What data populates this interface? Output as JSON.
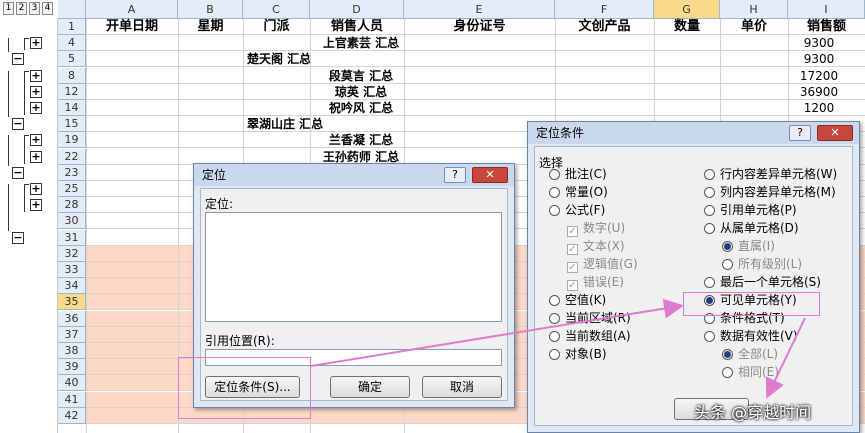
{
  "outline_levels": [
    "1",
    "2",
    "3",
    "4"
  ],
  "columns": [
    {
      "letter": "A",
      "header": "开单日期"
    },
    {
      "letter": "B",
      "header": "星期"
    },
    {
      "letter": "C",
      "header": "门派"
    },
    {
      "letter": "D",
      "header": "销售人员"
    },
    {
      "letter": "E",
      "header": "身份证号"
    },
    {
      "letter": "F",
      "header": "文创产品"
    },
    {
      "letter": "G",
      "header": "数量"
    },
    {
      "letter": "H",
      "header": "单价"
    },
    {
      "letter": "I",
      "header": "销售额"
    }
  ],
  "rows": [
    {
      "num": "1",
      "c": "",
      "d": "",
      "i": ""
    },
    {
      "num": "4",
      "c": "",
      "d": "上官素芸 汇总",
      "i": "9300"
    },
    {
      "num": "5",
      "c": "楚天阁 汇总",
      "d": "",
      "i": "9300"
    },
    {
      "num": "8",
      "c": "",
      "d": "段莫言 汇总",
      "i": "17200"
    },
    {
      "num": "12",
      "c": "",
      "d": "琼英 汇总",
      "i": "36900"
    },
    {
      "num": "14",
      "c": "",
      "d": "祝吟风 汇总",
      "i": "1200"
    },
    {
      "num": "15",
      "c": "翠湖山庄 汇总",
      "d": "",
      "i": ""
    },
    {
      "num": "19",
      "c": "",
      "d": "兰香凝 汇总",
      "i": ""
    },
    {
      "num": "22",
      "c": "",
      "d": "王孙药师 汇总",
      "i": ""
    },
    {
      "num": "23",
      "c": "",
      "d": "",
      "i": ""
    },
    {
      "num": "25",
      "c": "",
      "d": "",
      "i": ""
    },
    {
      "num": "28",
      "c": "",
      "d": "",
      "i": ""
    },
    {
      "num": "30",
      "c": "",
      "d": "",
      "i": ""
    },
    {
      "num": "31",
      "c": "",
      "d": "",
      "i": ""
    },
    {
      "num": "32",
      "c": "",
      "d": "",
      "i": ""
    },
    {
      "num": "33",
      "c": "",
      "d": "",
      "i": ""
    },
    {
      "num": "34",
      "c": "",
      "d": "",
      "i": ""
    },
    {
      "num": "35",
      "c": "",
      "d": "",
      "i": ""
    },
    {
      "num": "36",
      "c": "",
      "d": "",
      "i": ""
    },
    {
      "num": "37",
      "c": "",
      "d": "",
      "i": ""
    },
    {
      "num": "38",
      "c": "",
      "d": "",
      "i": ""
    },
    {
      "num": "39",
      "c": "",
      "d": "",
      "i": ""
    },
    {
      "num": "40",
      "c": "",
      "d": "",
      "i": ""
    },
    {
      "num": "41",
      "c": "",
      "d": "",
      "i": ""
    },
    {
      "num": "42",
      "c": "",
      "d": "",
      "i": ""
    }
  ],
  "goto_dialog": {
    "title": "定位",
    "help": "?",
    "close": "✕",
    "goto_label": "定位:",
    "reference_label": "引用位置(R):",
    "special_button": "定位条件(S)...",
    "ok_button": "确定",
    "cancel_button": "取消"
  },
  "special_dialog": {
    "title": "定位条件",
    "help": "?",
    "close": "✕",
    "section_label": "选择",
    "left_options": [
      {
        "label": "批注(C)",
        "type": "radio",
        "checked": false,
        "disabled": false
      },
      {
        "label": "常量(O)",
        "type": "radio",
        "checked": false,
        "disabled": false
      },
      {
        "label": "公式(F)",
        "type": "radio",
        "checked": false,
        "disabled": false
      },
      {
        "label": "数字(U)",
        "type": "check",
        "checked": true,
        "disabled": true
      },
      {
        "label": "文本(X)",
        "type": "check",
        "checked": true,
        "disabled": true
      },
      {
        "label": "逻辑值(G)",
        "type": "check",
        "checked": true,
        "disabled": true
      },
      {
        "label": "错误(E)",
        "type": "check",
        "checked": true,
        "disabled": true
      },
      {
        "label": "空值(K)",
        "type": "radio",
        "checked": false,
        "disabled": false
      },
      {
        "label": "当前区域(R)",
        "type": "radio",
        "checked": false,
        "disabled": false
      },
      {
        "label": "当前数组(A)",
        "type": "radio",
        "checked": false,
        "disabled": false
      },
      {
        "label": "对象(B)",
        "type": "radio",
        "checked": false,
        "disabled": false
      }
    ],
    "right_options": [
      {
        "label": "行内容差异单元格(W)",
        "type": "radio",
        "checked": false,
        "disabled": false
      },
      {
        "label": "列内容差异单元格(M)",
        "type": "radio",
        "checked": false,
        "disabled": false
      },
      {
        "label": "引用单元格(P)",
        "type": "radio",
        "checked": false,
        "disabled": false
      },
      {
        "label": "从属单元格(D)",
        "type": "radio",
        "checked": false,
        "disabled": false
      },
      {
        "label": "直属(I)",
        "type": "radio",
        "checked": true,
        "disabled": true
      },
      {
        "label": "所有级别(L)",
        "type": "radio",
        "checked": false,
        "disabled": true
      },
      {
        "label": "最后一个单元格(S)",
        "type": "radio",
        "checked": false,
        "disabled": false
      },
      {
        "label": "可见单元格(Y)",
        "type": "radio",
        "checked": true,
        "disabled": false
      },
      {
        "label": "条件格式(T)",
        "type": "radio",
        "checked": false,
        "disabled": false
      },
      {
        "label": "数据有效性(V)",
        "type": "radio",
        "checked": false,
        "disabled": false
      },
      {
        "label": "全部(L)",
        "type": "radio",
        "checked": true,
        "disabled": true
      },
      {
        "label": "相同(E)",
        "type": "radio",
        "checked": false,
        "disabled": true
      }
    ]
  },
  "watermark": "头条 @穿越时间",
  "colors": {
    "arrow": "#e07ad0",
    "selected_header": "#f9d98a",
    "pink_rows": "#fbd9c6"
  }
}
